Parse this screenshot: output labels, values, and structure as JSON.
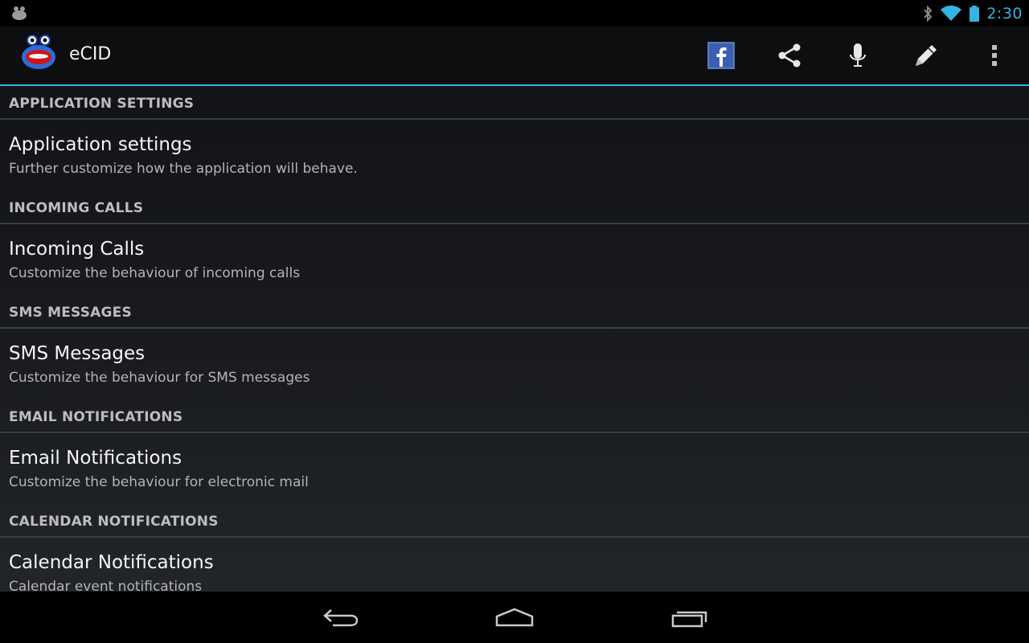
{
  "status_bar": {
    "time": "2:30",
    "left_icon": "android-debug-icon",
    "right_icons": [
      "bluetooth-icon",
      "wifi-icon",
      "battery-icon"
    ],
    "time_color": "#33b5e5"
  },
  "action_bar": {
    "title": "eCID",
    "app_icon": "ecid-logo-icon",
    "accent_color": "#33b5e5",
    "actions": [
      {
        "name": "facebook-button",
        "icon": "facebook-icon"
      },
      {
        "name": "share-button",
        "icon": "share-icon"
      },
      {
        "name": "microphone-button",
        "icon": "microphone-icon"
      },
      {
        "name": "edit-button",
        "icon": "pencil-icon"
      },
      {
        "name": "overflow-menu-button",
        "icon": "more-vertical-icon"
      }
    ]
  },
  "sections": [
    {
      "header": "APPLICATION SETTINGS",
      "item": {
        "title": "Application settings",
        "summary": "Further customize how the application will behave."
      }
    },
    {
      "header": "INCOMING CALLS",
      "item": {
        "title": "Incoming Calls",
        "summary": "Customize the behaviour of incoming calls"
      }
    },
    {
      "header": "SMS MESSAGES",
      "item": {
        "title": "SMS Messages",
        "summary": "Customize the behaviour for SMS messages"
      }
    },
    {
      "header": "EMAIL NOTIFICATIONS",
      "item": {
        "title": "Email Notifications",
        "summary": "Customize the behaviour for electronic mail"
      }
    },
    {
      "header": "CALENDAR NOTIFICATIONS",
      "item": {
        "title": "Calendar Notifications",
        "summary": "Calendar event notifications"
      }
    }
  ],
  "nav_bar": {
    "buttons": [
      "back-icon",
      "home-icon",
      "recent-apps-icon"
    ]
  }
}
